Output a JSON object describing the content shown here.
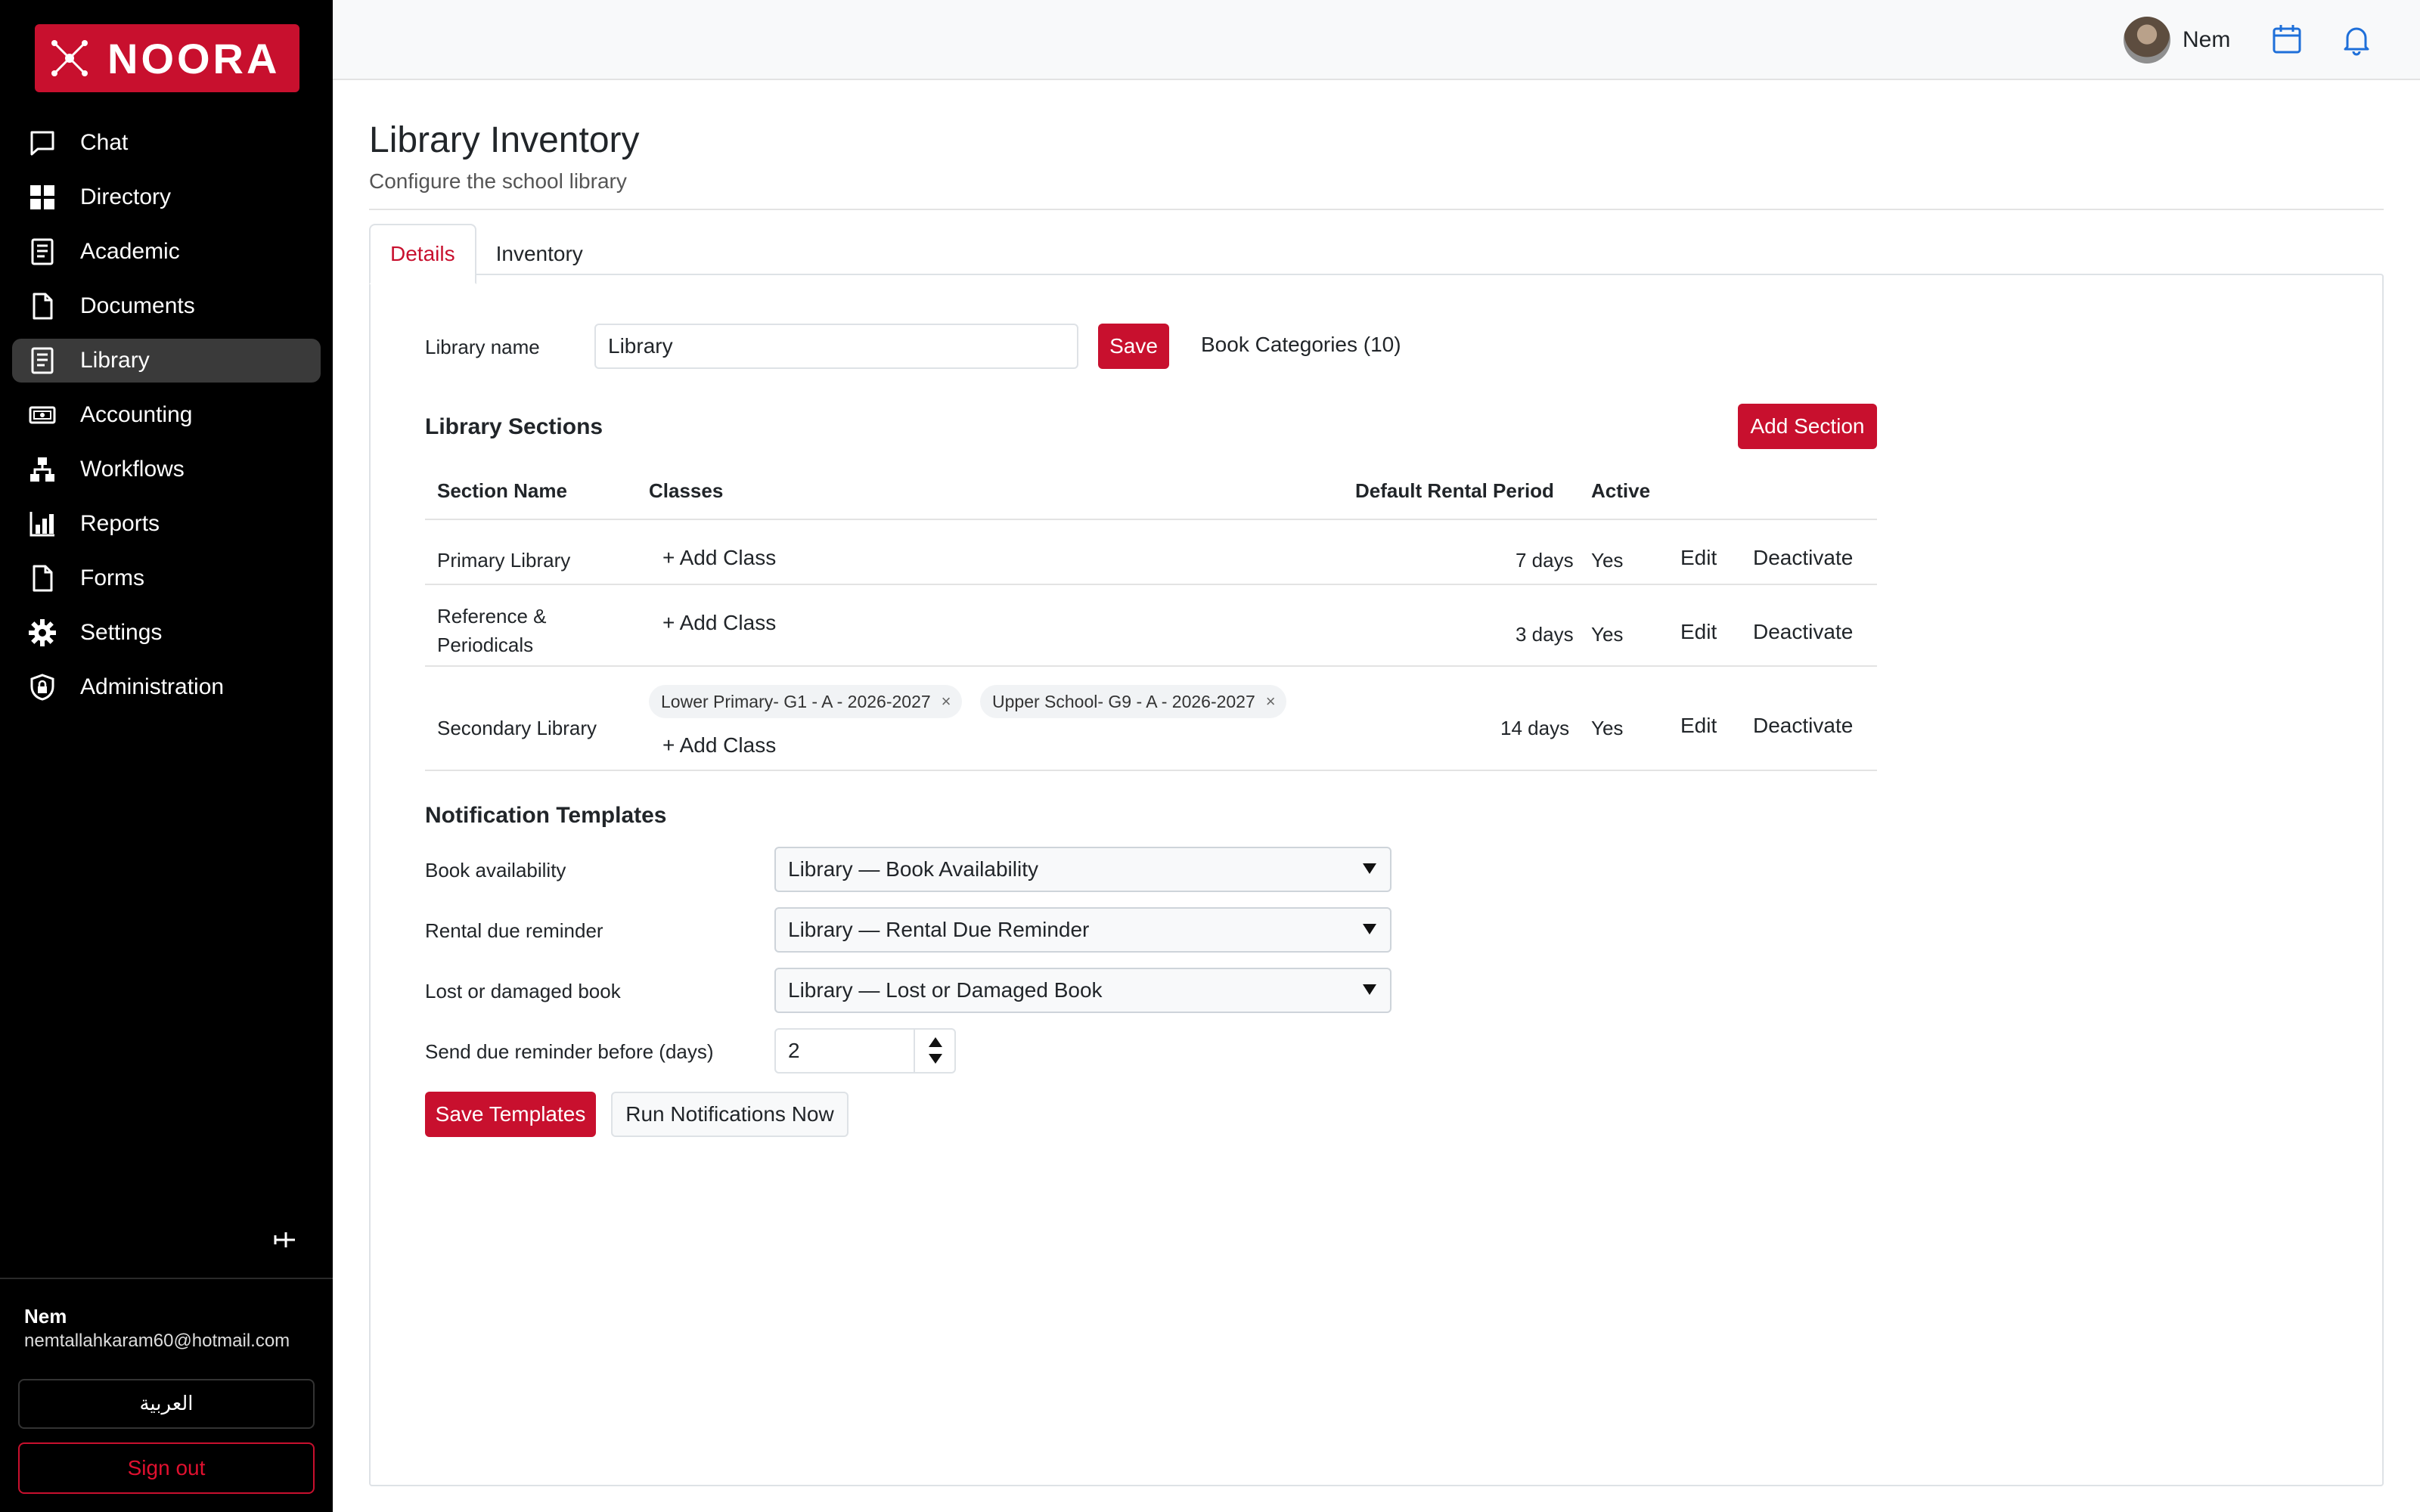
{
  "brand": {
    "name": "NOORA",
    "color": "#c8102e"
  },
  "sidebar": {
    "items": [
      {
        "label": "Chat",
        "icon": "chat-icon"
      },
      {
        "label": "Directory",
        "icon": "grid-icon"
      },
      {
        "label": "Academic",
        "icon": "notebook-icon"
      },
      {
        "label": "Documents",
        "icon": "document-icon"
      },
      {
        "label": "Library",
        "icon": "book-icon",
        "active": true
      },
      {
        "label": "Accounting",
        "icon": "money-icon"
      },
      {
        "label": "Workflows",
        "icon": "workflow-icon"
      },
      {
        "label": "Reports",
        "icon": "bar-chart-icon"
      },
      {
        "label": "Forms",
        "icon": "form-icon"
      },
      {
        "label": "Settings",
        "icon": "gear-icon"
      },
      {
        "label": "Administration",
        "icon": "shield-lock-icon"
      }
    ],
    "user": {
      "name": "Nem",
      "email": "nemtallahkaram60@hotmail.com"
    },
    "language_button": "العربية",
    "signout_button": "Sign out"
  },
  "topbar": {
    "user_name": "Nem"
  },
  "page": {
    "title": "Library Inventory",
    "subtitle": "Configure the school library",
    "tabs": [
      {
        "label": "Details",
        "active": true
      },
      {
        "label": "Inventory",
        "active": false
      }
    ]
  },
  "details": {
    "library_name_label": "Library name",
    "library_name_value": "Library",
    "save_label": "Save",
    "categories_label": "Book Categories (10)",
    "sections_heading": "Library Sections",
    "add_section_label": "Add Section",
    "columns": [
      "Section Name",
      "Classes",
      "Default Rental Period",
      "Active"
    ],
    "add_class_label": "+ Add Class",
    "edit_label": "Edit",
    "deactivate_label": "Deactivate",
    "sections": [
      {
        "name": "Primary Library",
        "classes": [],
        "rental": "7 days",
        "active": "Yes"
      },
      {
        "name_line1": "Reference &",
        "name_line2": "Periodicals",
        "classes": [],
        "rental": "3 days",
        "active": "Yes"
      },
      {
        "name": "Secondary Library",
        "classes": [
          "Lower Primary- G1 - A - 2026-2027",
          "Upper School- G9 - A - 2026-2027"
        ],
        "rental": "14 days",
        "active": "Yes"
      }
    ],
    "chip_remove": "×"
  },
  "notifications": {
    "heading": "Notification Templates",
    "rows": [
      {
        "label": "Book availability",
        "value": "Library — Book Availability"
      },
      {
        "label": "Rental due reminder",
        "value": "Library — Rental Due Reminder"
      },
      {
        "label": "Lost or damaged book",
        "value": "Library — Lost or Damaged Book"
      }
    ],
    "reminder_label": "Send due reminder before (days)",
    "reminder_value": "2",
    "save_templates_label": "Save Templates",
    "run_now_label": "Run Notifications Now"
  }
}
